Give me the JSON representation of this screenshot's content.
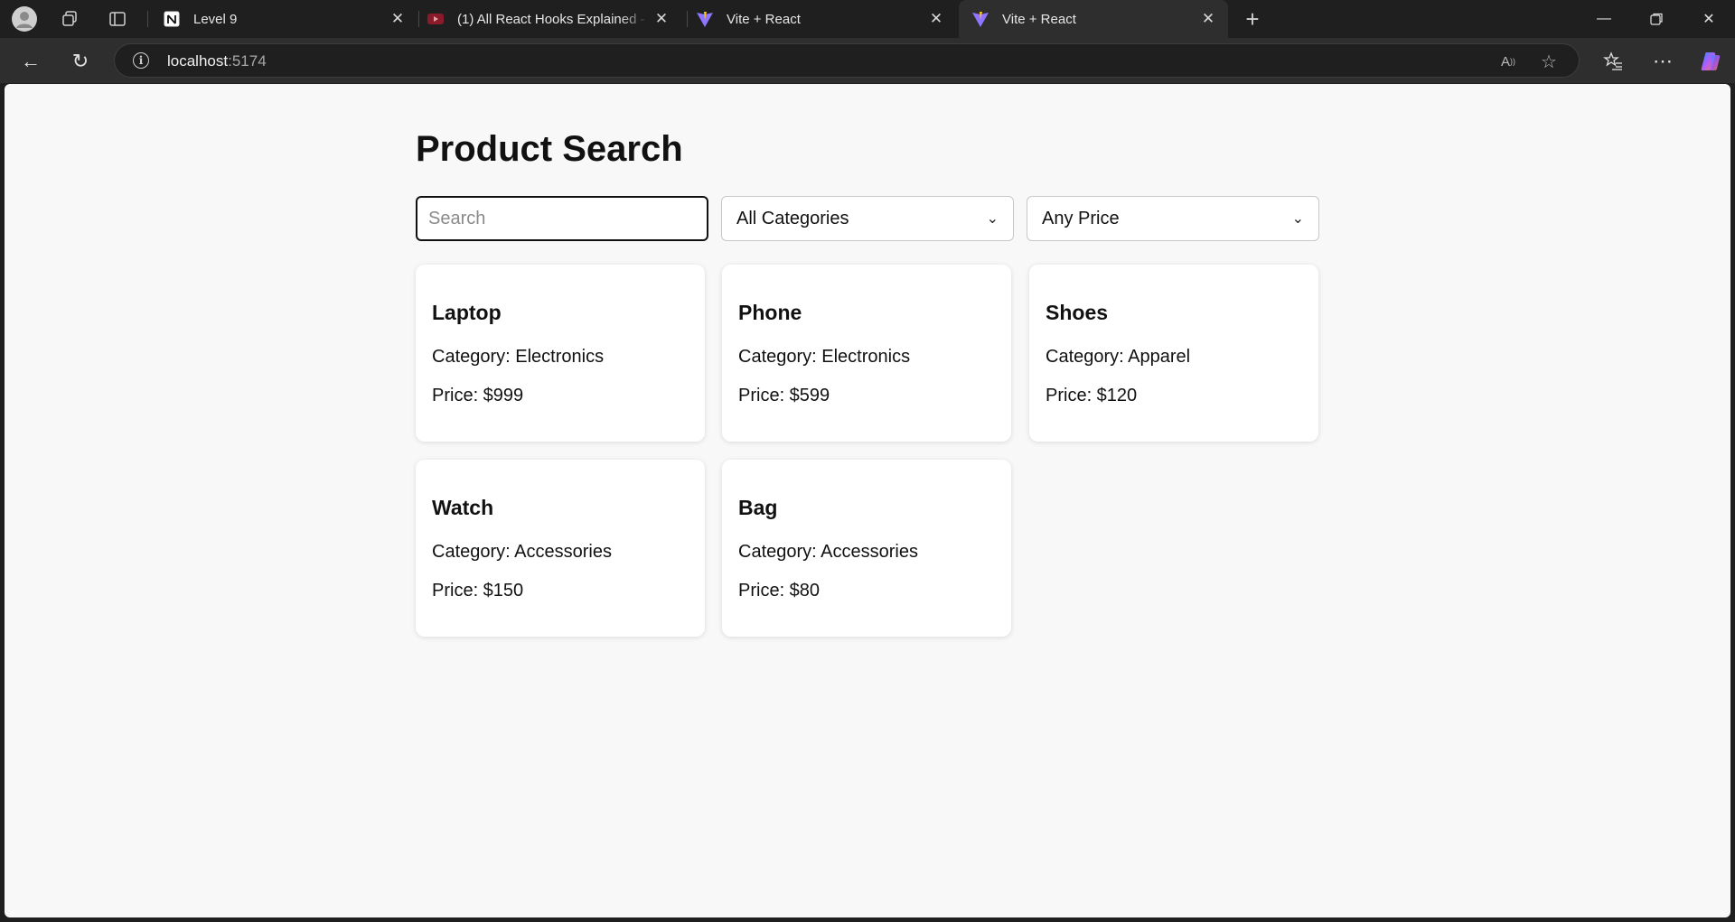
{
  "browser": {
    "tabs": [
      {
        "title": "Level 9",
        "icon": "notion-icon",
        "active": false
      },
      {
        "title": "(1) All React Hooks Explained - Re",
        "icon": "youtube-icon",
        "active": false
      },
      {
        "title": "Vite + React",
        "icon": "vite-icon",
        "active": false
      },
      {
        "title": "Vite + React",
        "icon": "vite-icon",
        "active": true
      }
    ],
    "url_host": "localhost",
    "url_port": ":5174"
  },
  "page": {
    "title": "Product Search",
    "search": {
      "placeholder": "Search",
      "value": ""
    },
    "category_select": {
      "selected": "All Categories"
    },
    "price_select": {
      "selected": "Any Price"
    },
    "products": [
      {
        "name": "Laptop",
        "category": "Category: Electronics",
        "price": "Price: $999"
      },
      {
        "name": "Phone",
        "category": "Category: Electronics",
        "price": "Price: $599"
      },
      {
        "name": "Shoes",
        "category": "Category: Apparel",
        "price": "Price: $120"
      },
      {
        "name": "Watch",
        "category": "Category: Accessories",
        "price": "Price: $150"
      },
      {
        "name": "Bag",
        "category": "Category: Accessories",
        "price": "Price: $80"
      }
    ]
  },
  "colors": {
    "chrome_bg": "#1f1f1f",
    "toolbar_bg": "#2e2e2e",
    "page_bg": "#f8f8f8",
    "card_bg": "#ffffff",
    "text": "#111111"
  }
}
